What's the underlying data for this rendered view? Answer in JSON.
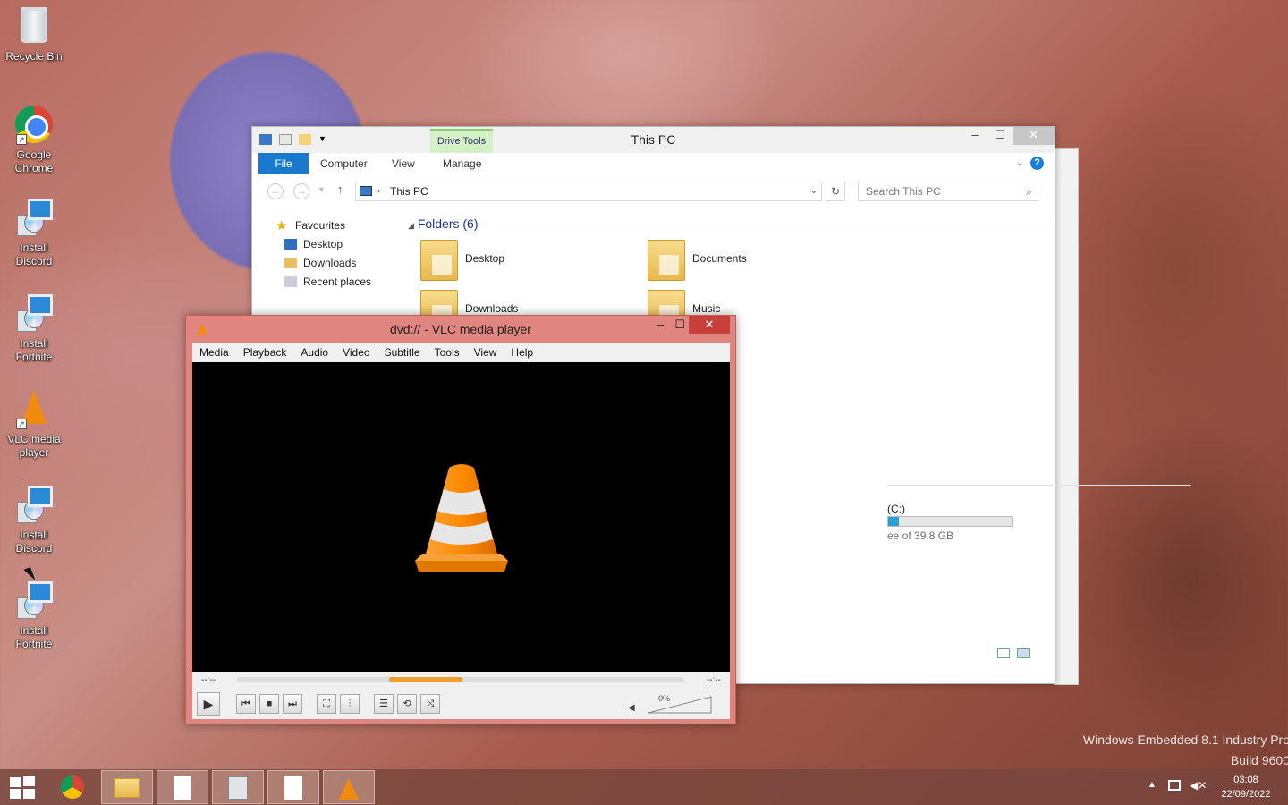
{
  "desktop": {
    "icons": [
      {
        "label": "Recycle Bin"
      },
      {
        "label": "Google Chrome"
      },
      {
        "label": "Install Discord"
      },
      {
        "label": "Install Fortnite"
      },
      {
        "label": "VLC media player"
      },
      {
        "label": "Install Discord"
      },
      {
        "label": "Install Fortnite"
      }
    ],
    "watermark": {
      "line1": "Windows Embedded 8.1 Industry Pro",
      "line2": "Build 9600"
    }
  },
  "explorer": {
    "title": "This PC",
    "contextual_tab": "Drive Tools",
    "tabs": {
      "file": "File",
      "computer": "Computer",
      "view": "View",
      "manage": "Manage"
    },
    "address": "This PC",
    "search_placeholder": "Search This PC",
    "nav": {
      "favourites": "Favourites",
      "items": [
        "Desktop",
        "Downloads",
        "Recent places"
      ]
    },
    "folders_header": "Folders (6)",
    "folders": [
      "Desktop",
      "Documents",
      "Downloads",
      "Music"
    ],
    "drive": {
      "label": "(C:)",
      "free_text": "ee of 39.8 GB",
      "used_fraction": 0.09
    }
  },
  "vlc": {
    "title": "dvd:// - VLC media player",
    "menu": [
      "Media",
      "Playback",
      "Audio",
      "Video",
      "Subtitle",
      "Tools",
      "View",
      "Help"
    ],
    "time_elapsed": "--:--",
    "time_total": "--:--",
    "volume": "0%"
  },
  "taskbar": {
    "clock_time": "03:08",
    "clock_date": "22/09/2022"
  },
  "colors": {
    "vlc_orange": "#f08a10",
    "explorer_accent": "#1979ca"
  }
}
